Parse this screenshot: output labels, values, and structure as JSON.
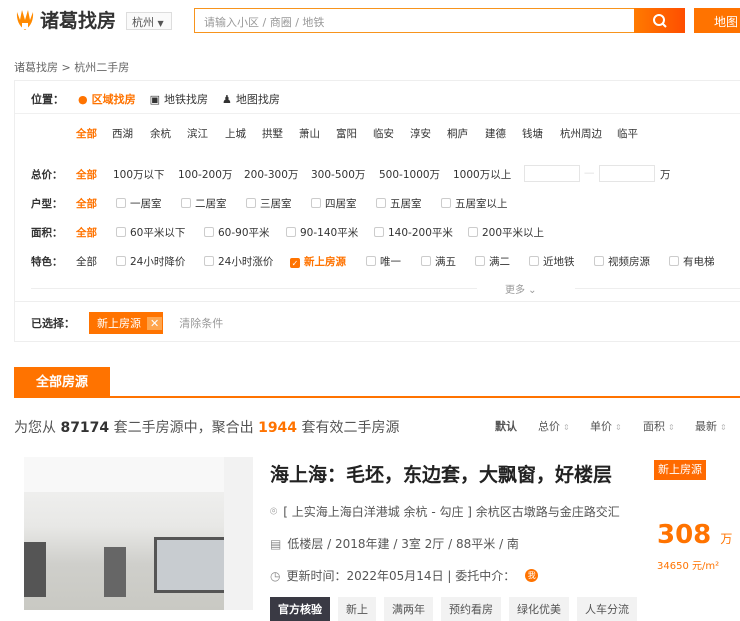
{
  "header": {
    "logo": "诸葛找房",
    "city": "杭州",
    "search_placeholder": "请输入小区 / 商圈 / 地铁",
    "map_button": "地图"
  },
  "breadcrumb": "诸葛找房 > 杭州二手房",
  "filter": {
    "location_label": "位置：",
    "location_tabs": [
      "区域找房",
      "地铁找房",
      "地图找房"
    ],
    "districts": [
      "全部",
      "西湖",
      "余杭",
      "滨江",
      "上城",
      "拱墅",
      "萧山",
      "富阳",
      "临安",
      "淳安",
      "桐庐",
      "建德",
      "钱塘",
      "杭州周边",
      "临平"
    ],
    "price_label": "总价：",
    "prices": [
      "全部",
      "100万以下",
      "100-200万",
      "200-300万",
      "300-500万",
      "500-1000万",
      "1000万以上"
    ],
    "price_unit": "万",
    "price_sep": "—",
    "layout_label": "户型：",
    "layouts": [
      "全部",
      "一居室",
      "二居室",
      "三居室",
      "四居室",
      "五居室",
      "五居室以上"
    ],
    "area_label": "面积：",
    "areas": [
      "全部",
      "60平米以下",
      "60-90平米",
      "90-140平米",
      "140-200平米",
      "200平米以上"
    ],
    "feature_label": "特色：",
    "features": [
      "全部",
      "24小时降价",
      "24小时涨价",
      "新上房源",
      "唯一",
      "满五",
      "满二",
      "近地铁",
      "视频房源",
      "有电梯"
    ],
    "more": "更多",
    "selected_label": "已选择：",
    "selected_chip": "新上房源",
    "clear": "清除条件"
  },
  "tab": "全部房源",
  "stats": {
    "prefix": "为您从",
    "total": "87174",
    "mid": "套二手房源中，聚合出",
    "valid": "1944",
    "suffix": "套有效二手房源"
  },
  "sort": [
    "默认",
    "总价",
    "单价",
    "面积",
    "最新"
  ],
  "listing": {
    "title": "海上海：毛坯，东边套，大飘窗，好楼层",
    "badge": "新上房源",
    "address": "[ 上实海上海白洋港城 余杭 - 勾庄 ] 余杭区古墩路与金庄路交汇",
    "details": "低楼层 / 2018年建 / 3室 2厅 / 88平米 / 南",
    "update": "更新时间：2022年05月14日 | 委托中介：",
    "agent_badge": "我",
    "price": "308",
    "price_unit": "万",
    "unit_price": "34650 元/m²",
    "tags": [
      "官方核验",
      "新上",
      "满两年",
      "预约看房",
      "绿化优美",
      "人车分流"
    ]
  },
  "colors": {
    "accent": "#ff7300"
  }
}
